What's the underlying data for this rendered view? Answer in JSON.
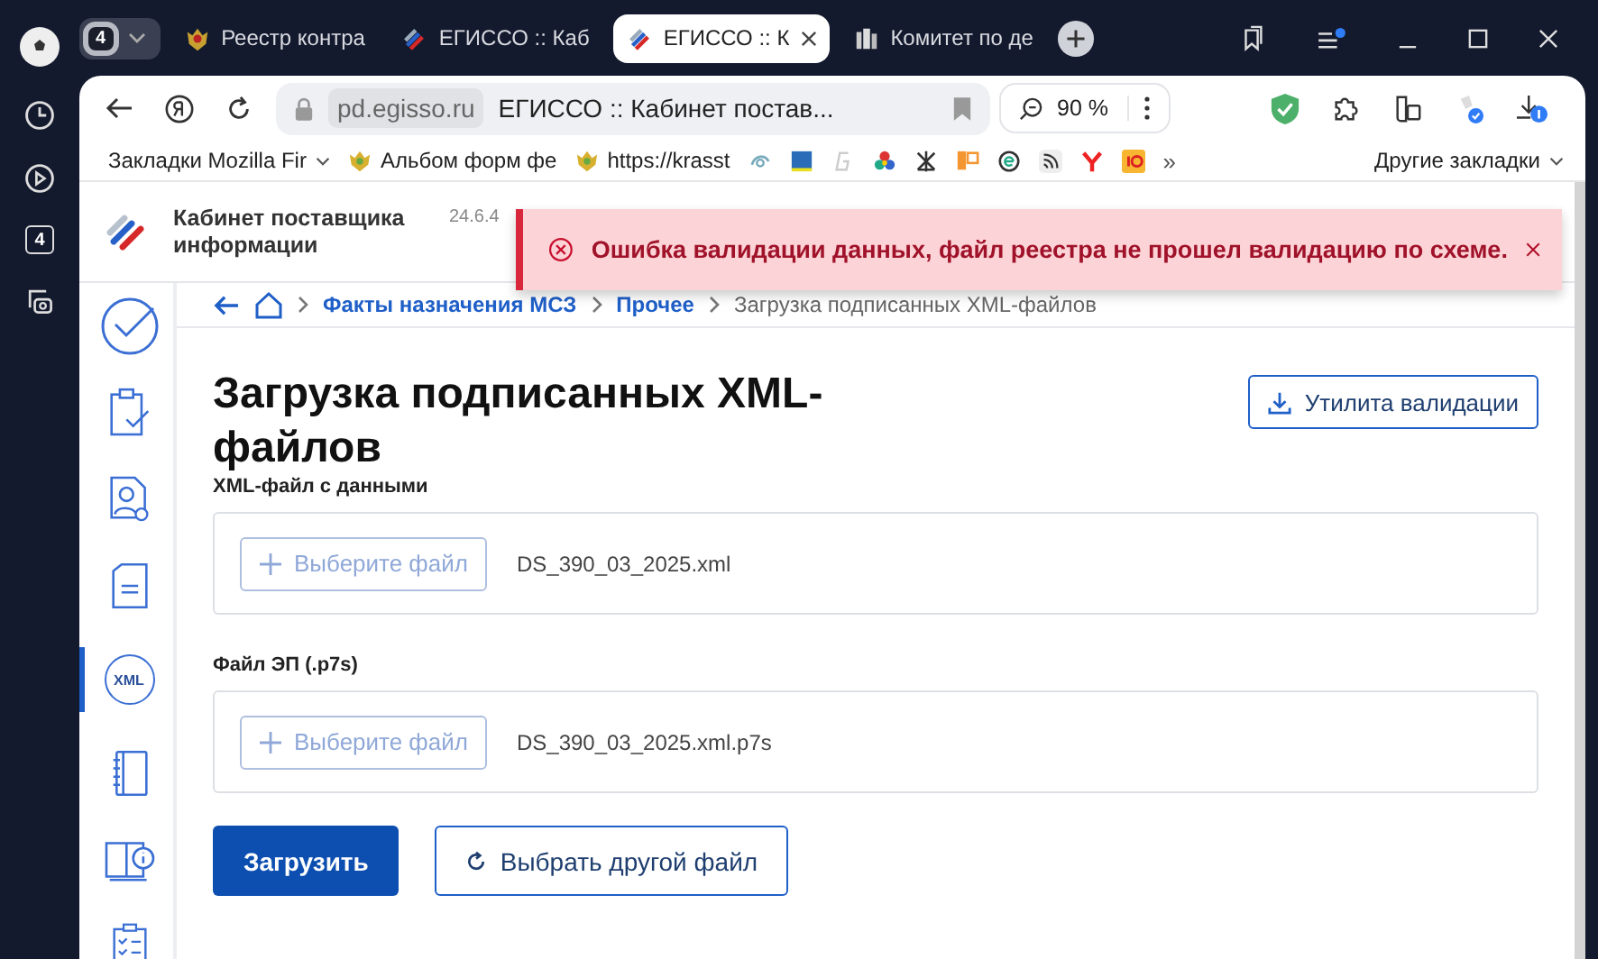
{
  "rail": {
    "badge": "4"
  },
  "tab_group": {
    "count": "4"
  },
  "tabs": [
    {
      "title": "Реестр контра",
      "selected": false
    },
    {
      "title": "ЕГИССО :: Каб",
      "selected": false
    },
    {
      "title": "ЕГИССО :: К",
      "selected": true
    },
    {
      "title": "Комитет по де",
      "selected": false
    }
  ],
  "address_bar": {
    "domain": "pd.egisso.ru",
    "title": "ЕГИССО :: Кабинет постав...",
    "zoom": "90 %"
  },
  "bookmarks": [
    {
      "label": "Закладки Mozilla Fir",
      "kind": "folder"
    },
    {
      "label": "Альбом форм фе",
      "kind": "link"
    },
    {
      "label": "https://krasst",
      "kind": "link"
    }
  ],
  "more_bookmarks": "»",
  "other_bookmarks": "Другие закладки",
  "header": {
    "title": "Кабинет поставщика информации",
    "version": "24.6.4"
  },
  "toast": {
    "kind": "error",
    "message": "Ошибка валидации данных, файл реестра не прошел валидацию по схеме."
  },
  "breadcrumbs": [
    {
      "label": "Факты назначения МСЗ",
      "kind": "link"
    },
    {
      "label": "Прочее",
      "kind": "link"
    },
    {
      "label": "Загрузка подписанных XML-файлов",
      "kind": "current"
    }
  ],
  "sidebar": {
    "items": [
      {
        "selected": false
      },
      {
        "selected": false
      },
      {
        "selected": false
      },
      {
        "selected": false
      },
      {
        "label": "XML",
        "selected": true
      },
      {
        "selected": false
      },
      {
        "selected": false
      },
      {
        "selected": false
      }
    ]
  },
  "page": {
    "title": "Загрузка подписанных XML-файлов",
    "validation_button": "Утилита валидации"
  },
  "file_fields": [
    {
      "label": "XML-файл с данными",
      "button": "Выберите файл",
      "file_name": "DS_390_03_2025.xml"
    },
    {
      "label": "Файл ЭП (.p7s)",
      "button": "Выберите файл",
      "file_name": "DS_390_03_2025.xml.p7s"
    }
  ],
  "actions": {
    "submit": "Загрузить",
    "change": "Выбрать другой файл"
  }
}
